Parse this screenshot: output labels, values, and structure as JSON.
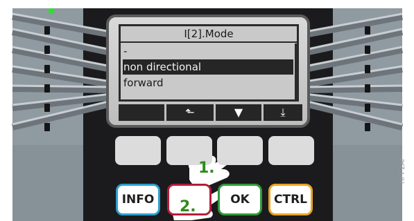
{
  "display": {
    "title": "I[2].Mode",
    "options": [
      "-",
      "non directional",
      "forward"
    ],
    "selected_option": "non directional"
  },
  "softkeys": [
    {
      "name": "empty",
      "glyph": ""
    },
    {
      "name": "parent-up-icon",
      "glyph": "⬑"
    },
    {
      "name": "arrow-down-icon",
      "glyph": "▼"
    },
    {
      "name": "page-down-icon",
      "glyph": "⤓"
    }
  ],
  "keys": {
    "info": "INFO",
    "esc": "",
    "ok": "OK",
    "ctrl": "CTRL"
  },
  "steps": {
    "step1": "1.",
    "step2": "2."
  },
  "colors": {
    "info_border": "#2aa0cc",
    "esc_border": "#b31e3a",
    "ok_border": "#2f9a3a",
    "ctrl_border": "#e8a423",
    "step_text": "#2f8a1e",
    "led_green": "#33dd33"
  },
  "watermark": "HPT ZAF"
}
